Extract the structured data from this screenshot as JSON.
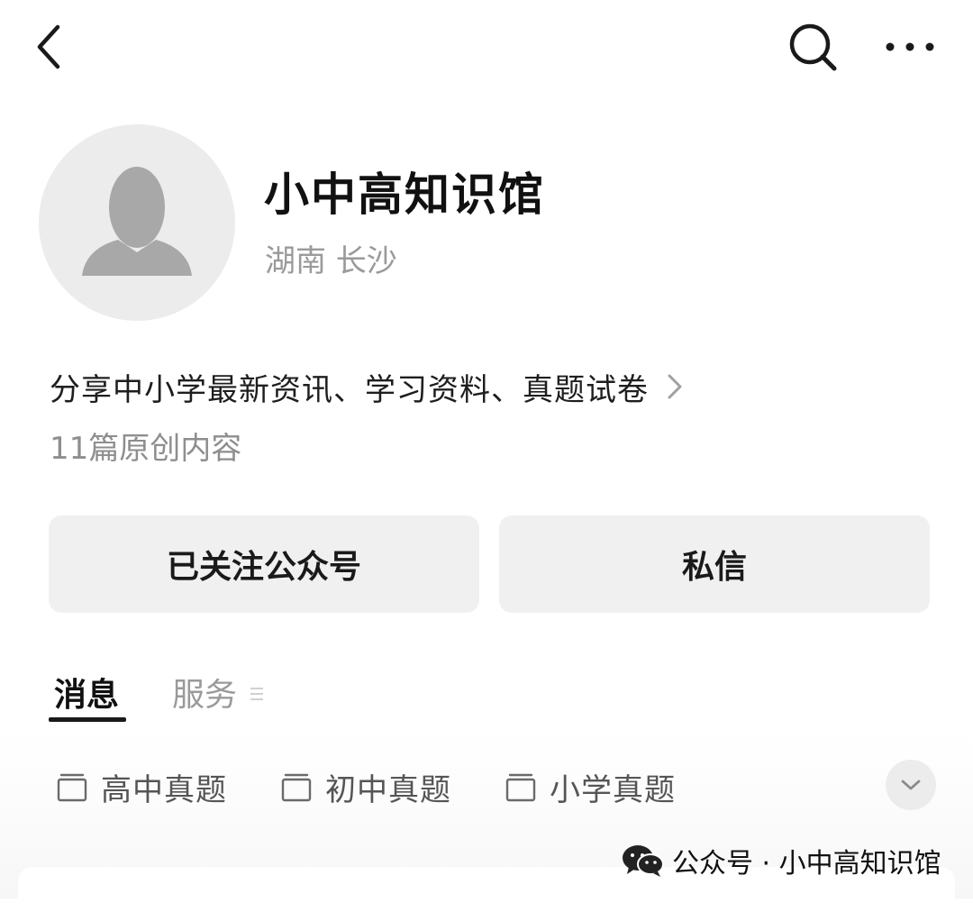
{
  "topbar": {
    "back_icon": "chevron-left-icon",
    "search_icon": "search-icon",
    "more_icon": "more-dots-icon"
  },
  "profile": {
    "avatar_icon": "user-silhouette-icon",
    "name": "小中高知识馆",
    "location": "湖南 长沙",
    "intro": "分享中小学最新资讯、学习资料、真题试卷",
    "original_count": "11篇原创内容"
  },
  "actions": {
    "follow_label": "已关注公众号",
    "message_label": "私信"
  },
  "tabs": [
    {
      "label": "消息",
      "active": true
    },
    {
      "label": "服务",
      "active": false
    }
  ],
  "albums": [
    {
      "label": "高中真题",
      "icon": "album-icon"
    },
    {
      "label": "初中真题",
      "icon": "album-icon"
    },
    {
      "label": "小学真题",
      "icon": "album-icon"
    }
  ],
  "expand_icon": "chevron-down-icon",
  "watermark": {
    "text": "公众号 · 小中高知识馆",
    "icon": "wechat-logo"
  },
  "colors": {
    "background": "#ffffff",
    "button_bg": "#f0f0f0",
    "secondary_text": "#9a9a9a",
    "primary_text": "#1a1a1a"
  }
}
